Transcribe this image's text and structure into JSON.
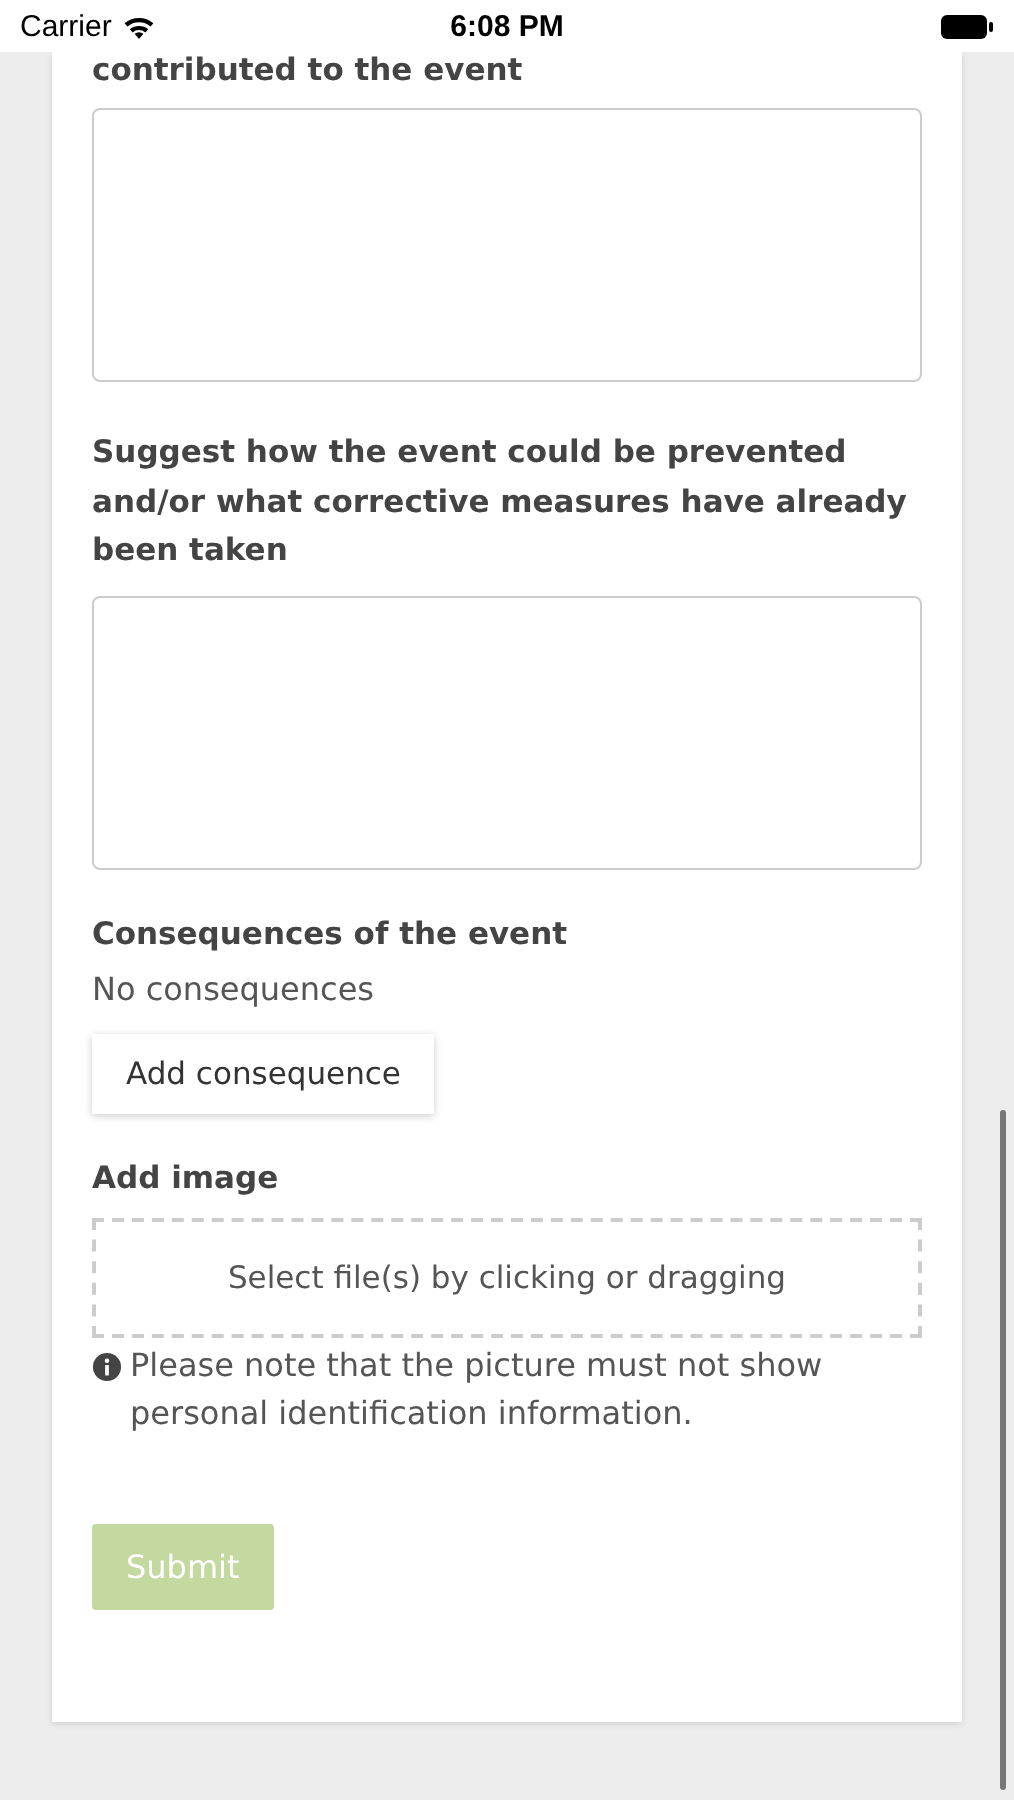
{
  "status_bar": {
    "carrier": "Carrier",
    "time": "6:08 PM"
  },
  "form": {
    "cut_label": "contributed to the event",
    "fields": [
      {
        "kind": "textarea"
      },
      {
        "kind": "textarea",
        "label": "Suggest how the event could be prevented and/or what corrective measures have already been taken"
      }
    ],
    "consequences": {
      "label": "Consequences of the event",
      "empty_text": "No consequences",
      "add_button": "Add consequence"
    },
    "image": {
      "label": "Add image",
      "dropzone": "Select file(s) by clicking or dragging",
      "note": "Please note that the picture must not show personal identification information."
    },
    "submit": {
      "label": "Submit",
      "disabled": true
    }
  }
}
